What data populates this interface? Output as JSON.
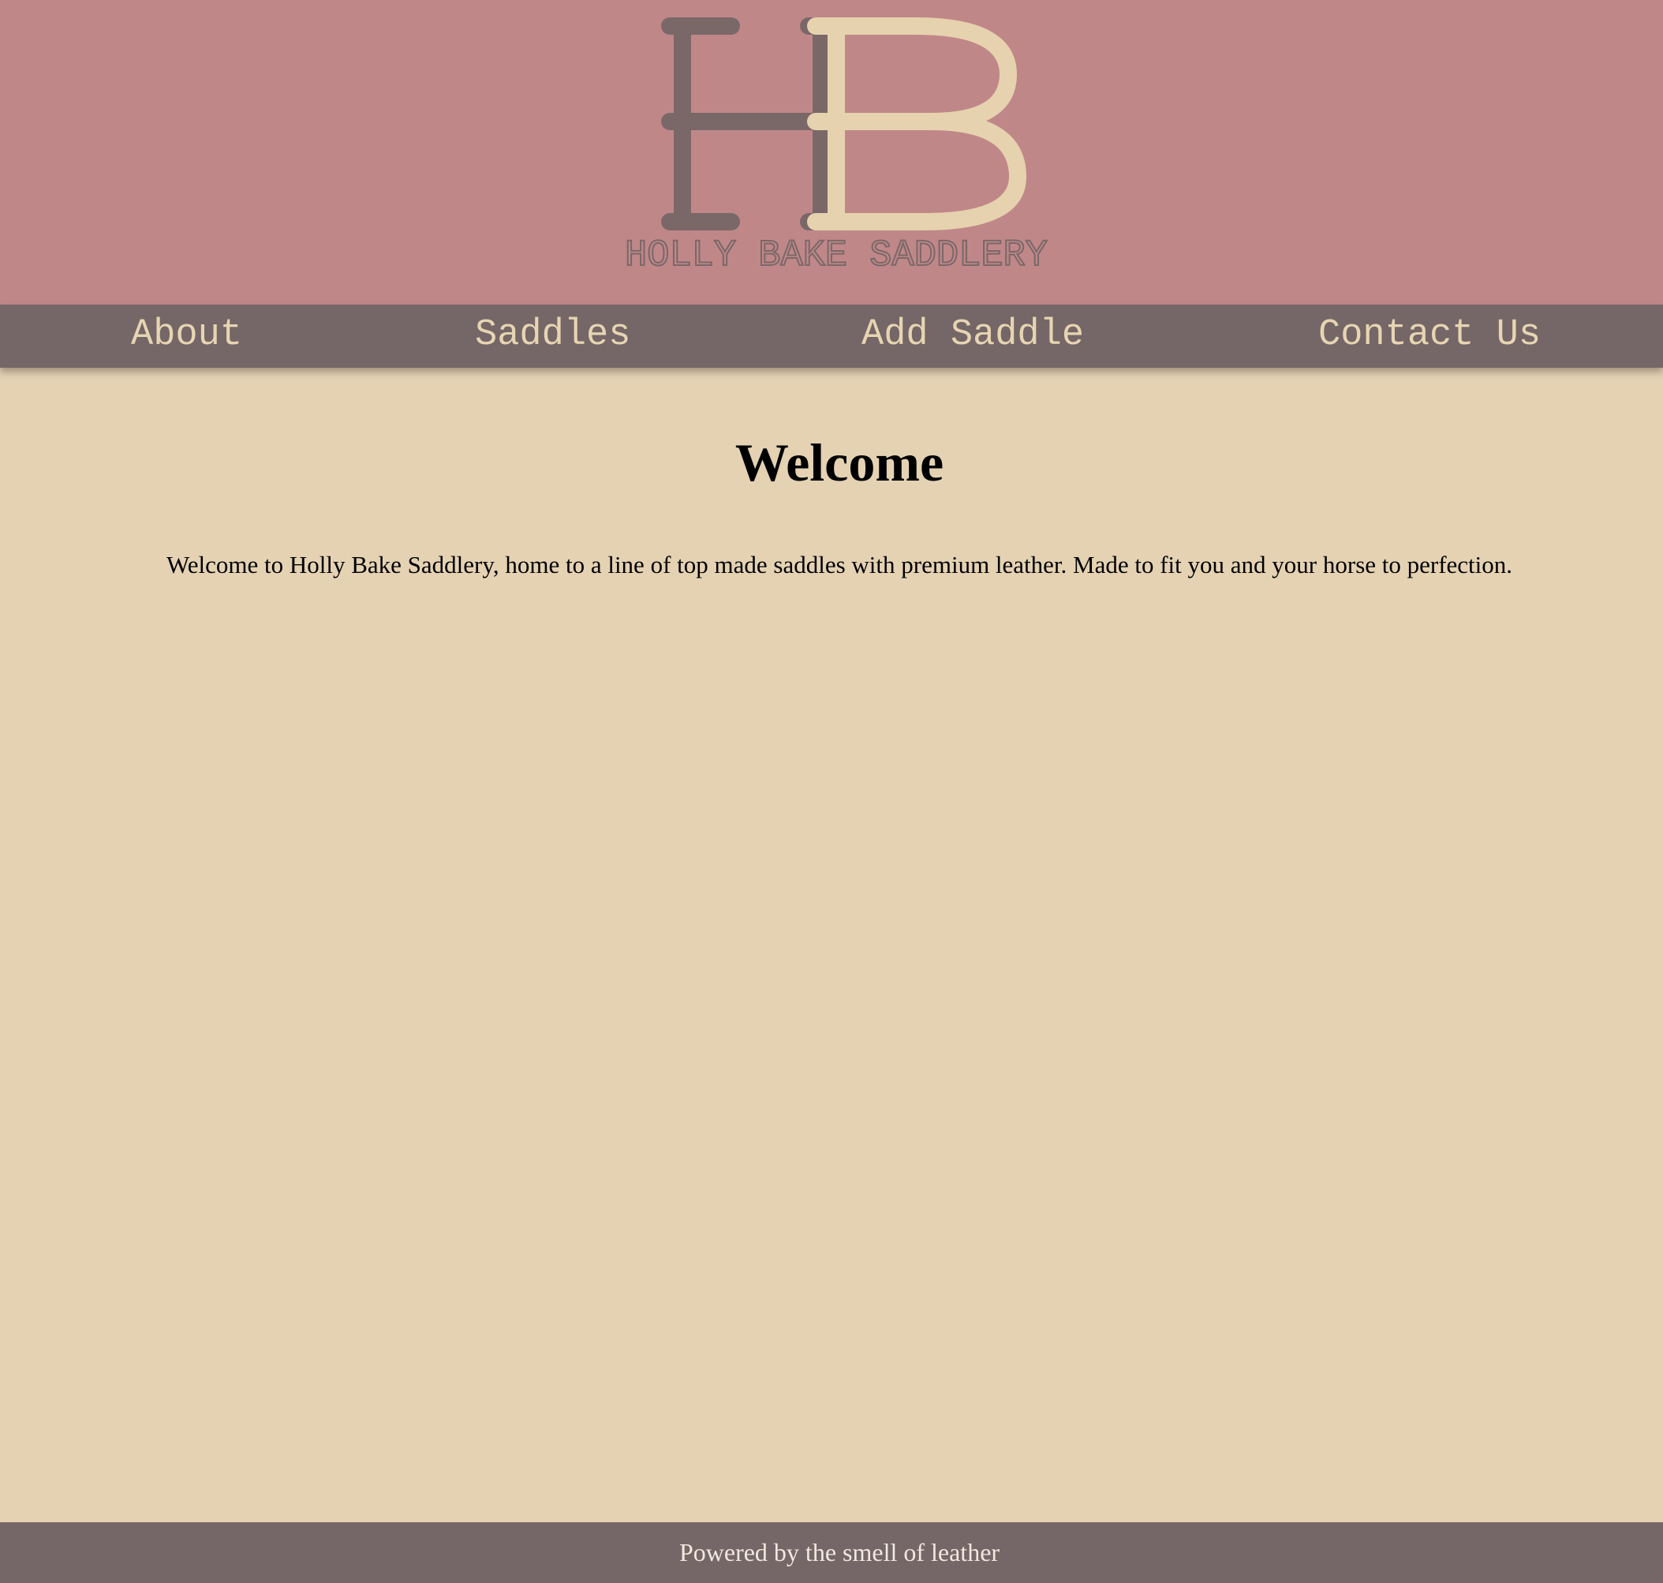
{
  "header": {
    "logo_monogram": "HB",
    "logo_wordmark": "HOLLY BAKE SADDLERY"
  },
  "nav": {
    "items": [
      {
        "label": "About"
      },
      {
        "label": "Saddles"
      },
      {
        "label": "Add Saddle"
      },
      {
        "label": "Contact Us"
      }
    ]
  },
  "main": {
    "title": "Welcome",
    "intro": "Welcome to Holly Bake Saddlery, home to a line of top made saddles with premium leather. Made to fit you and your horse to perfection."
  },
  "footer": {
    "text": "Powered by the smell of leather"
  },
  "colors": {
    "header_bg": "#c08789",
    "nav_bg": "#756667",
    "nav_text": "#e6d5b2",
    "page_bg": "#e4d2b3",
    "footer_bg": "#756667",
    "footer_text": "#f1e8de",
    "logo_dark": "#7a6868",
    "logo_light": "#e6d2ae"
  }
}
